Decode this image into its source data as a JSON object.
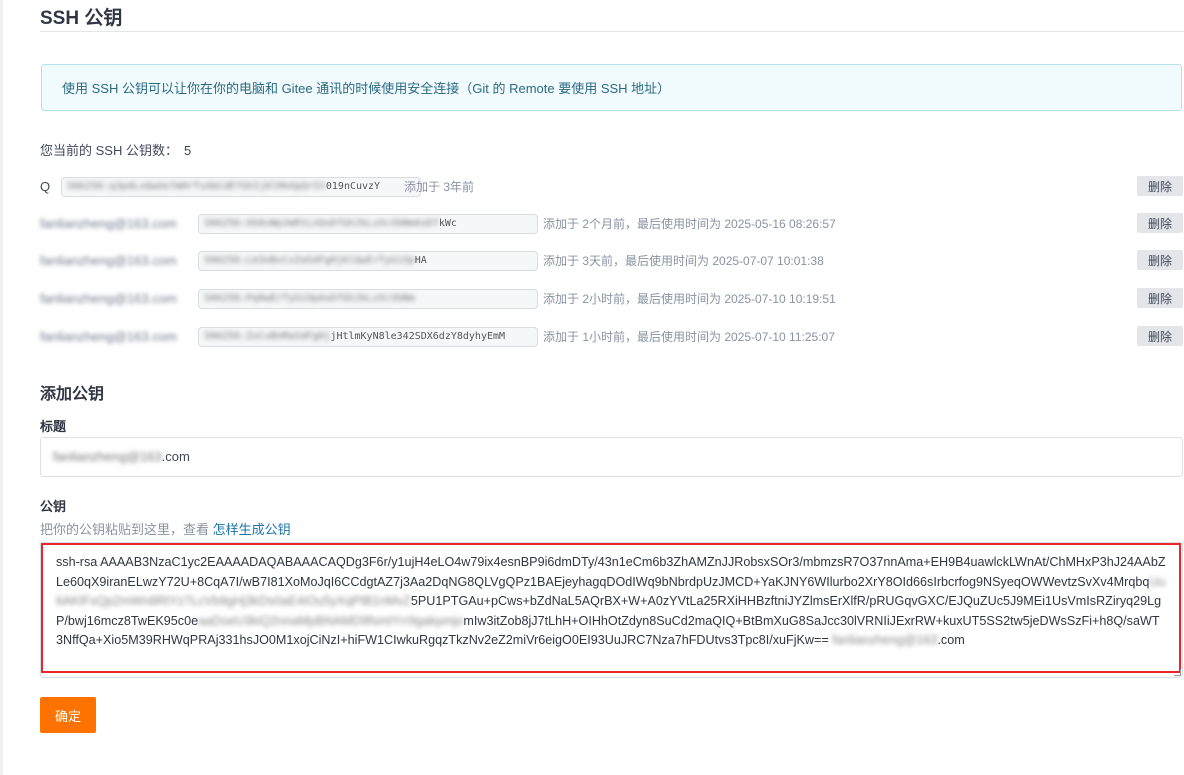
{
  "page_title": "SSH 公钥",
  "info_text": "使用 SSH 公钥可以让你在你的电脑和 Gitee 通讯的时候使用安全连接（Git 的 Remote 要使用 SSH 地址）",
  "key_count_label": "您当前的 SSH 公钥数：",
  "key_count": "5",
  "keys": [
    {
      "name": "Q",
      "fingerprint_hidden": "SHA256:q3pdLxQwUe7mHrTsAbCdEfGhIjKlMnOpQrSt",
      "fingerprint_visible": "019nCuvzY",
      "meta": "添加于 3年前",
      "delete_label": "删除"
    },
    {
      "name": "fanlianzheng@163.com",
      "fingerprint_hidden": "SHA256:Xk8vWp2mRtLnQsDfGhJkLzXcVbNmAsDf",
      "fingerprint_visible": "kWc",
      "meta": "添加于 2个月前，最后使用时间为 2025-05-16 08:26:57",
      "delete_label": "删除"
    },
    {
      "name": "fanlianzheng@163.com",
      "fingerprint_hidden": "SHA256:Lm3nBvCxZaSdFgHjKlQwErTyUiOp",
      "fingerprint_visible": "HA",
      "meta": "添加于 3天前，最后使用时间为 2025-07-07 10:01:38",
      "delete_label": "删除"
    },
    {
      "name": "fanlianzheng@163.com",
      "fingerprint_hidden": "SHA256:Pq9wErTyUiOpAsDfGhJkLzXcVbNm",
      "fingerprint_visible": "",
      "meta": "添加于 2小时前，最后使用时间为 2025-07-10 10:19:51",
      "delete_label": "删除"
    },
    {
      "name": "fanlianzheng@163.com",
      "fingerprint_hidden": "SHA256:ZxCvBnMaSdFgHj",
      "fingerprint_visible": "jHtlmKyN8le342SDX6dzY8dyhyEmM",
      "meta": "添加于 1小时前，最后使用时间为 2025-07-10 11:25:07",
      "delete_label": "删除"
    }
  ],
  "add_section_title": "添加公钥",
  "title_field": {
    "label": "标题",
    "value_hidden": "fanlianzheng@163",
    "value_visible": ".com"
  },
  "key_field": {
    "label": "公钥",
    "hint": "把你的公钥粘贴到这里，查看 ",
    "hint_link": "怎样生成公钥",
    "value_part1": "ssh-rsa AAAAB3NzaC1yc2EAAAADAQABAAACAQDg3F6r/y1ujH4eLO4w79ix4esnBP9i6dmDTy/43n1eCm6b3ZhAMZnJJRobsxSOr3/mbmzsR7O37nnAma+EH9B4uawlckLWnAt/ChMHxP3hJ24AAbZLe60qX9iranELwzY72U+8CqA7I/wB7I81XoMoJqI6CCdgtAZ7j3Aa2DqNG8QLVgQPz1BAEjeyhagqDOdIWq9bNbrdpUzJMCD+YaKJNY6WIlurbo2XrY8OId66sIrbcrfog9NSyeqOWWevtzSvXv4Mrqbq",
    "value_hidden1": "Uu6AKlFxQp2mWn8RtYz7LcVb9gHj3kDs0aE4iOu5yXqPtB1nMvZ",
    "value_part2": "5PU1PTGAu+pCws+bZdNaL5AQrBX+W+A0zYVtLa25RXiHHBzftniJYZlmsErXlfR/pRUGqvGXC/EJQuZUc5J9MEi1UsVmIsRZiryq29LgP/bwj16mcz8TwEK95c0e",
    "value_hidden2": "aaDoeU3kiQ2nnaMpBNAMD9fsmtYrr9gakpmjo",
    "value_part3": "mIw3itZob8jJ7tLhH+OIHhOtZdyn8SuCd2maQIQ+BtBmXuG8SaJcc30lVRNIiJExrRW+kuxUT5SS2tw5jeDWsSzFi+h8Q/saWT3NffQa+Xio5M39RHWqPRAj331hsJO0M1xojCiNzI+hiFW1CIwkuRgqzTkzNv2eZ2miVr6eigO0EI93UuJRC7Nza7hFDUtvs3Tpc8I/xuFjKw== ",
    "value_hidden3": "fanlianzheng@163",
    "value_part4": ".com"
  },
  "confirm_label": "确定"
}
